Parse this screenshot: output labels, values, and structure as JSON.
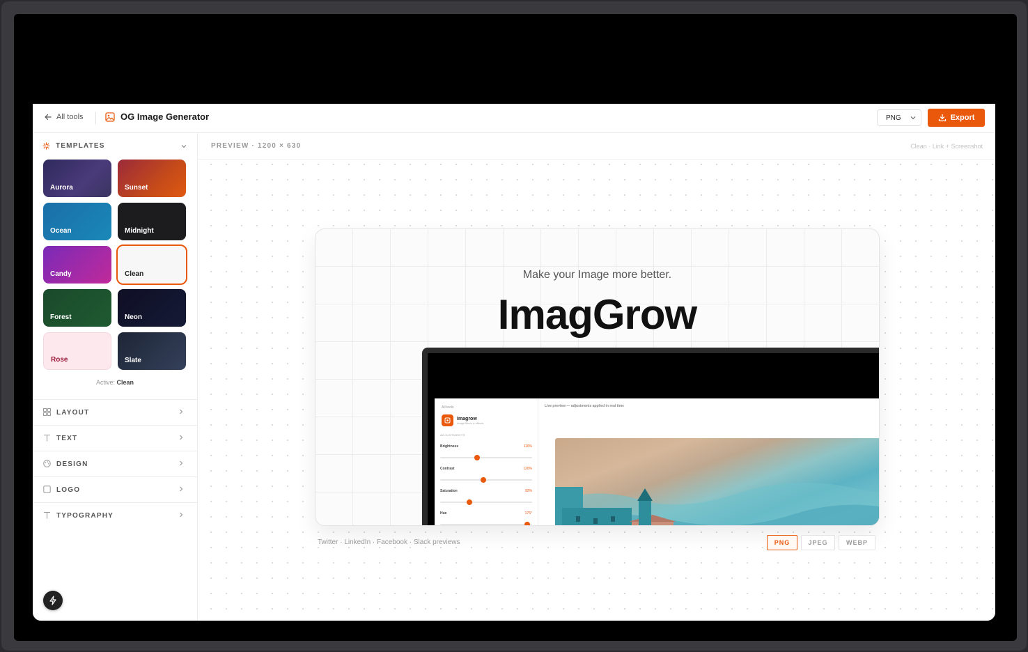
{
  "header": {
    "back_label": "All tools",
    "title": "OG Image Generator",
    "format_select": "PNG",
    "export_label": "Export"
  },
  "sidebar": {
    "templates_title": "TEMPLATES",
    "templates": [
      {
        "name": "Aurora"
      },
      {
        "name": "Sunset"
      },
      {
        "name": "Ocean"
      },
      {
        "name": "Midnight"
      },
      {
        "name": "Candy"
      },
      {
        "name": "Clean"
      },
      {
        "name": "Forest"
      },
      {
        "name": "Neon"
      },
      {
        "name": "Rose"
      },
      {
        "name": "Slate"
      }
    ],
    "active_prefix": "Active:",
    "active_value": "Clean",
    "sections": [
      "LAYOUT",
      "TEXT",
      "DESIGN",
      "LOGO",
      "TYPOGRAPHY"
    ]
  },
  "preview": {
    "label": "PREVIEW · 1200 × 630",
    "meta": "Clean · Link + Screenshot",
    "tagline": "Make your Image more better.",
    "headline": "ImagGrow",
    "platforms": "Twitter · LinkedIn · Facebook · Slack previews",
    "formats": [
      "PNG",
      "JPEG",
      "WEBP"
    ],
    "selected_format": "PNG"
  },
  "screenshot": {
    "back": "All tools",
    "app_name": "Imagrow",
    "app_sub": "Image filters & effects",
    "section": "ADJUSTMENTS",
    "top_text": "Live preview — adjustments applied in real time",
    "adjustments": [
      {
        "label": "Brightness",
        "value": "110%",
        "level": 0.4
      },
      {
        "label": "Contrast",
        "value": "120%",
        "level": 0.47
      },
      {
        "label": "Saturation",
        "value": "92%",
        "level": 0.31
      },
      {
        "label": "Hue",
        "value": "176°",
        "level": 0.95
      }
    ]
  },
  "colors": {
    "accent": "#ea580c"
  }
}
